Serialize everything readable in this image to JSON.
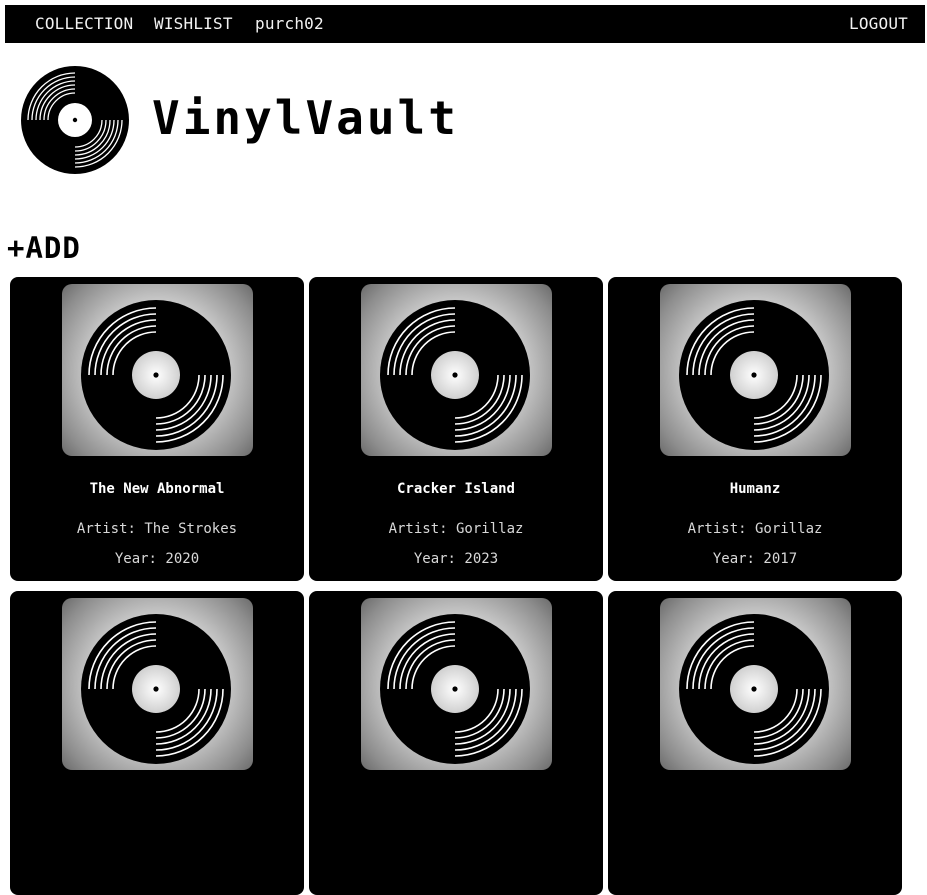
{
  "nav": {
    "collection": "COLLECTION",
    "wishlist": "WISHLIST",
    "username": "purch02",
    "logout": "LOGOUT"
  },
  "brand": {
    "title": "VinylVault"
  },
  "actions": {
    "add_label": "+ADD"
  },
  "albums": [
    {
      "title": "The New Abnormal",
      "artist": "Artist: The Strokes",
      "year": "Year: 2020"
    },
    {
      "title": "Cracker Island",
      "artist": "Artist: Gorillaz",
      "year": "Year: 2023"
    },
    {
      "title": "Humanz",
      "artist": "Artist: Gorillaz",
      "year": "Year: 2017"
    },
    {
      "title": "",
      "artist": "",
      "year": ""
    },
    {
      "title": "",
      "artist": "",
      "year": ""
    },
    {
      "title": "",
      "artist": "",
      "year": ""
    }
  ],
  "colors": {
    "navbar": "#000000",
    "card": "#000000",
    "page": "#ffffff"
  },
  "icons": {
    "logo": "vinyl-record-icon",
    "cover": "vinyl-record-icon"
  }
}
